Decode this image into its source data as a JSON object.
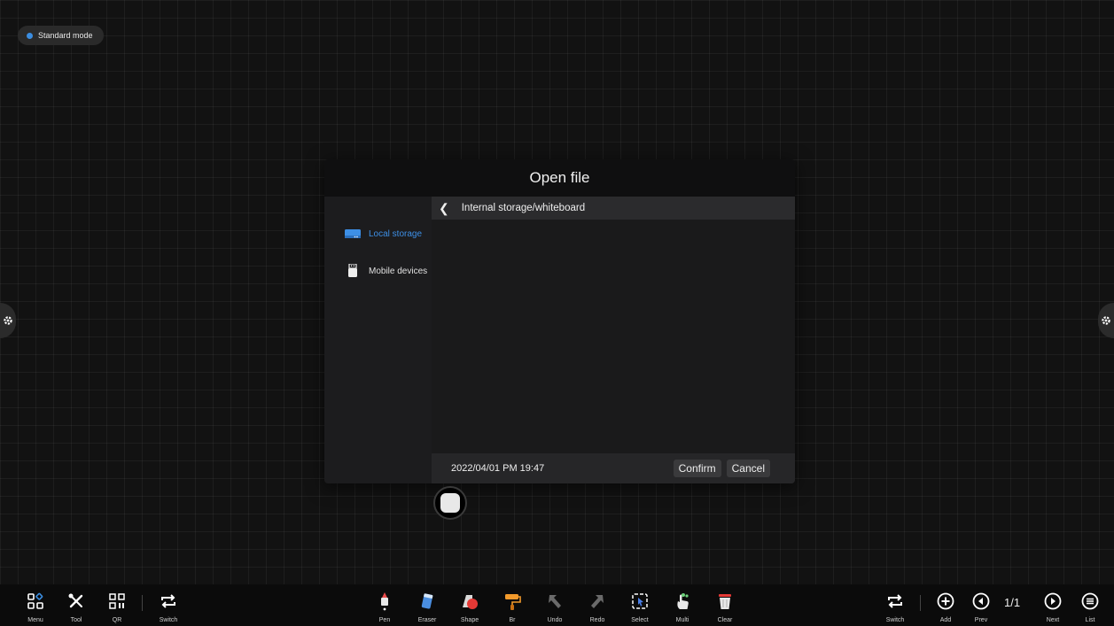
{
  "mode": {
    "label": "Standard mode",
    "accent": "#3b8de0"
  },
  "dialog": {
    "title": "Open file",
    "path": "Internal storage/whiteboard",
    "sidebar": [
      {
        "label": "Local storage",
        "icon": "hard-drive-icon",
        "active": true
      },
      {
        "label": "Mobile devices",
        "icon": "usb-drive-icon",
        "active": false
      }
    ],
    "footer": {
      "date": "2022/04/01 PM 19:47",
      "confirm": "Confirm",
      "cancel": "Cancel"
    }
  },
  "toolbar": {
    "left": {
      "menu": "Menu",
      "tool": "Tool",
      "qr": "QR",
      "switch": "Switch"
    },
    "center": {
      "pen": "Pen",
      "eraser": "Eraser",
      "shape": "Shape",
      "brush": "Br",
      "undo": "Undo",
      "redo": "Redo",
      "select": "Select",
      "multi": "Multi",
      "clear": "Clear"
    },
    "right": {
      "switch": "Switch",
      "add": "Add",
      "prev": "Prev",
      "page": "1/1",
      "next": "Next",
      "list": "List"
    }
  }
}
